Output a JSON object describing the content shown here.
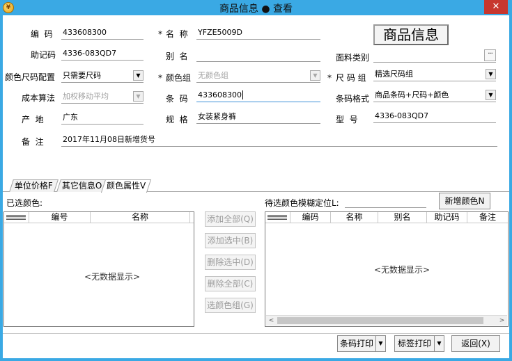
{
  "window": {
    "title": "商品信息 ● 查看",
    "close": "✕",
    "app_icon": "¥"
  },
  "form": {
    "code_label": "编  码",
    "code_value": "433608300",
    "name_star": "*",
    "name_label": "名  称",
    "name_value": "YFZE5009D",
    "goods_info_button": "商品信息",
    "mnemonic_label": "助记码",
    "mnemonic_value": "4336-083QD7",
    "alias_label": "别  名",
    "alias_value": "",
    "fabric_label": "面料类别",
    "fabric_value": "",
    "fabric_button": "···",
    "color_size_label": "颜色尺码配置",
    "color_size_value": "只需要尺码",
    "color_group_star": "*",
    "color_group_label": "颜色组",
    "color_group_value": "无颜色组",
    "size_group_star": "*",
    "size_group_label": "尺 码 组",
    "size_group_value": "精选尺码组",
    "cost_label": "成本算法",
    "cost_value": "加权移动平均",
    "barcode_label": "条  码",
    "barcode_value": "433608300",
    "barcode_format_label": "条码格式",
    "barcode_format_value": "商品条码+尺码+颜色",
    "origin_label": "产  地",
    "origin_value": "广东",
    "spec_label": "规  格",
    "spec_value": "女装紧身裤",
    "model_label": "型  号",
    "model_value": "4336-083QD7",
    "remark_label": "备  注",
    "remark_value": "2017年11月08日新增货号"
  },
  "tabs": [
    {
      "label": "单位价格F"
    },
    {
      "label": "其它信息O"
    },
    {
      "label": "颜色属性V"
    }
  ],
  "selected_colors": {
    "label": "已选颜色:",
    "columns": [
      "编号",
      "名称"
    ],
    "empty_text": "<无数据显示>"
  },
  "middle_buttons": [
    {
      "label": "添加全部(Q)"
    },
    {
      "label": "添加选中(B)"
    },
    {
      "label": "删除选中(D)"
    },
    {
      "label": "删除全部(C)"
    },
    {
      "label": "选颜色组(G)"
    }
  ],
  "candidate_colors": {
    "label": "待选颜色模糊定位L:",
    "search_value": "",
    "new_color_button": "新增颜色N",
    "columns": [
      "编码",
      "名称",
      "别名",
      "助记码",
      "备注"
    ],
    "empty_text": "<无数据显示>"
  },
  "footer": {
    "barcode_print": "条码打印",
    "label_print": "标签打印",
    "return": "返回(X)",
    "dropdown_arrow": "▼"
  },
  "icons": {
    "dropdown": "▼",
    "scroll_left": "<",
    "scroll_right": ">"
  }
}
